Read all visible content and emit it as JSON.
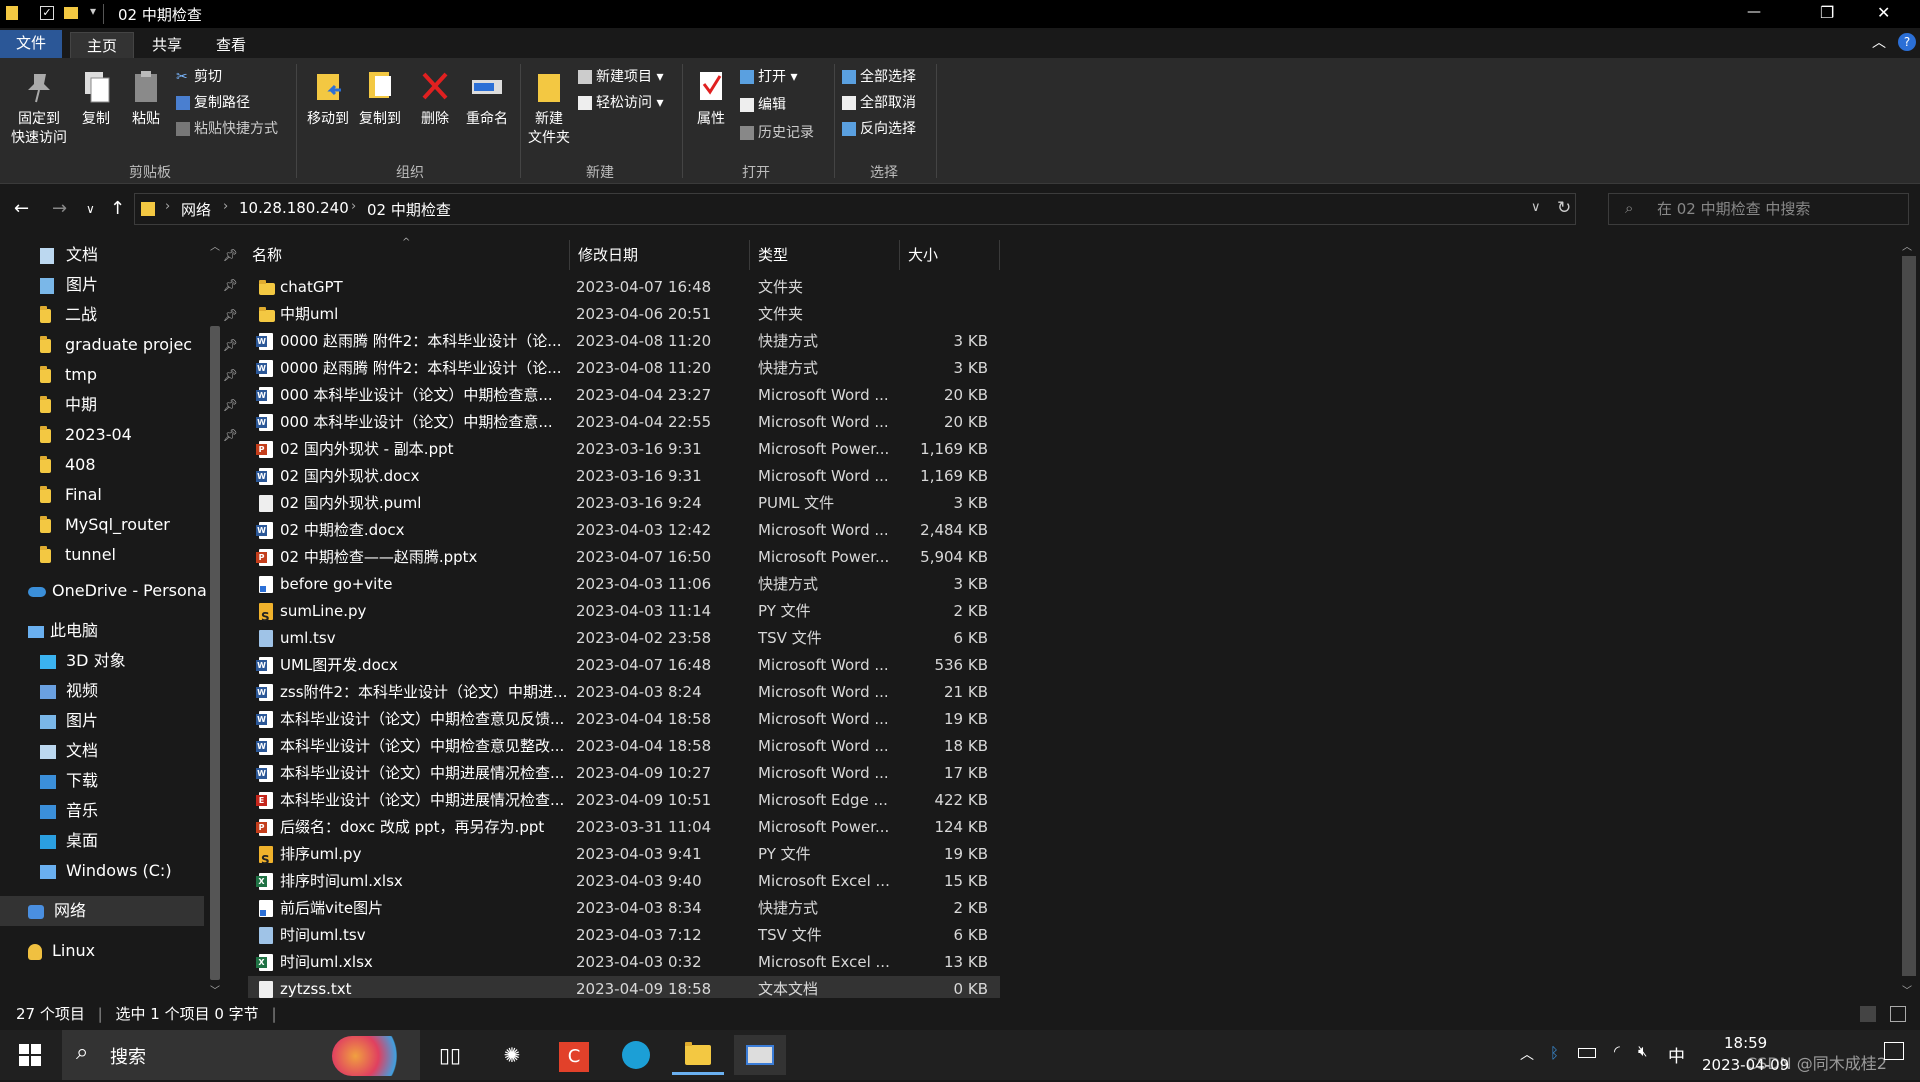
{
  "titlebar": {
    "title": "02 中期检查",
    "qat_dropdown": "▾",
    "minimize": "—",
    "restore": "❐",
    "close": "✕"
  },
  "ribbon_tabs": [
    {
      "label": "文件"
    },
    {
      "label": "主页"
    },
    {
      "label": "共享"
    },
    {
      "label": "查看"
    }
  ],
  "ribbon": {
    "pin_quick_access": "固定到\n快速访问",
    "copy": "复制",
    "paste": "粘贴",
    "cut": "剪切",
    "copy_path": "复制路径",
    "paste_shortcut": "粘贴快捷方式",
    "group_clipboard": "剪贴板",
    "move_to": "移动到",
    "copy_to": "复制到",
    "delete": "删除",
    "rename": "重命名",
    "group_organize": "组织",
    "new_folder": "新建\n文件夹",
    "new_item": "新建项目",
    "easy_access": "轻松访问",
    "group_new": "新建",
    "properties": "属性",
    "open": "打开",
    "edit": "编辑",
    "history": "历史记录",
    "group_open": "打开",
    "select_all": "全部选择",
    "select_none": "全部取消",
    "invert_selection": "反向选择",
    "group_select": "选择"
  },
  "address": {
    "crumbs": [
      "网络",
      "10.28.180.240",
      "02 中期检查"
    ],
    "search_placeholder": "在 02 中期检查 中搜索"
  },
  "nav_pane": {
    "quick_access": [
      {
        "label": "文档",
        "icon": "documents-icon",
        "pinned": true
      },
      {
        "label": "图片",
        "icon": "pictures-icon",
        "pinned": true
      },
      {
        "label": "二战",
        "icon": "folder-icon",
        "pinned": true
      },
      {
        "label": "graduate projec",
        "icon": "folder-icon",
        "pinned": true
      },
      {
        "label": "tmp",
        "icon": "folder-icon",
        "pinned": true
      },
      {
        "label": "中期",
        "icon": "folder-icon",
        "pinned": true
      },
      {
        "label": "2023-04",
        "icon": "folder-icon",
        "pinned": true
      },
      {
        "label": "408",
        "icon": "folder-icon",
        "pinned": false
      },
      {
        "label": "Final",
        "icon": "folder-icon",
        "pinned": false
      },
      {
        "label": "MySql_router",
        "icon": "folder-icon",
        "pinned": false
      },
      {
        "label": "tunnel",
        "icon": "folder-icon",
        "pinned": false
      }
    ],
    "onedrive": "OneDrive - Personal",
    "this_pc": "此电脑",
    "this_pc_items": [
      {
        "label": "3D 对象",
        "icon": "3d-objects-icon"
      },
      {
        "label": "视频",
        "icon": "videos-icon"
      },
      {
        "label": "图片",
        "icon": "pictures-icon"
      },
      {
        "label": "文档",
        "icon": "documents-icon"
      },
      {
        "label": "下载",
        "icon": "downloads-icon"
      },
      {
        "label": "音乐",
        "icon": "music-icon"
      },
      {
        "label": "桌面",
        "icon": "desktop-icon"
      },
      {
        "label": "Windows (C:)",
        "icon": "drive-icon"
      }
    ],
    "network": "网络",
    "linux": "Linux"
  },
  "columns": {
    "name": "名称",
    "date": "修改日期",
    "type": "类型",
    "size": "大小"
  },
  "files": [
    {
      "name": "chatGPT",
      "date": "2023-04-07 16:48",
      "type": "文件夹",
      "size": "",
      "icon": "folder"
    },
    {
      "name": "中期uml",
      "date": "2023-04-06 20:51",
      "type": "文件夹",
      "size": "",
      "icon": "folder"
    },
    {
      "name": "0000 赵雨腾 附件2：本科毕业设计（论...",
      "date": "2023-04-08 11:20",
      "type": "快捷方式",
      "size": "3 KB",
      "icon": "word-lnk"
    },
    {
      "name": "0000 赵雨腾 附件2：本科毕业设计（论...",
      "date": "2023-04-08 11:20",
      "type": "快捷方式",
      "size": "3 KB",
      "icon": "word-lnk"
    },
    {
      "name": "000 本科毕业设计（论文）中期检查意...",
      "date": "2023-04-04 23:27",
      "type": "Microsoft Word ...",
      "size": "20 KB",
      "icon": "word"
    },
    {
      "name": "000 本科毕业设计（论文）中期检查意...",
      "date": "2023-04-04 22:55",
      "type": "Microsoft Word ...",
      "size": "20 KB",
      "icon": "word"
    },
    {
      "name": "02 国内外现状 - 副本.ppt",
      "date": "2023-03-16 9:31",
      "type": "Microsoft Power...",
      "size": "1,169 KB",
      "icon": "ppt"
    },
    {
      "name": "02 国内外现状.docx",
      "date": "2023-03-16 9:31",
      "type": "Microsoft Word ...",
      "size": "1,169 KB",
      "icon": "word"
    },
    {
      "name": "02 国内外现状.puml",
      "date": "2023-03-16 9:24",
      "type": "PUML 文件",
      "size": "3 KB",
      "icon": "txt"
    },
    {
      "name": "02 中期检查.docx",
      "date": "2023-04-03 12:42",
      "type": "Microsoft Word ...",
      "size": "2,484 KB",
      "icon": "word"
    },
    {
      "name": "02 中期检查——赵雨腾.pptx",
      "date": "2023-04-07 16:50",
      "type": "Microsoft Power...",
      "size": "5,904 KB",
      "icon": "ppt"
    },
    {
      "name": "before go+vite",
      "date": "2023-04-03 11:06",
      "type": "快捷方式",
      "size": "3 KB",
      "icon": "lnk"
    },
    {
      "name": "sumLine.py",
      "date": "2023-04-03 11:14",
      "type": "PY 文件",
      "size": "2 KB",
      "icon": "py"
    },
    {
      "name": "uml.tsv",
      "date": "2023-04-02 23:58",
      "type": "TSV 文件",
      "size": "6 KB",
      "icon": "tsv"
    },
    {
      "name": "UML图开发.docx",
      "date": "2023-04-07 16:48",
      "type": "Microsoft Word ...",
      "size": "536 KB",
      "icon": "word"
    },
    {
      "name": "zss附件2：本科毕业设计（论文）中期进...",
      "date": "2023-04-03 8:24",
      "type": "Microsoft Word ...",
      "size": "21 KB",
      "icon": "word"
    },
    {
      "name": "本科毕业设计（论文）中期检查意见反馈...",
      "date": "2023-04-04 18:58",
      "type": "Microsoft Word ...",
      "size": "19 KB",
      "icon": "word"
    },
    {
      "name": "本科毕业设计（论文）中期检查意见整改...",
      "date": "2023-04-04 18:58",
      "type": "Microsoft Word ...",
      "size": "18 KB",
      "icon": "word"
    },
    {
      "name": "本科毕业设计（论文）中期进展情况检查...",
      "date": "2023-04-09 10:27",
      "type": "Microsoft Word ...",
      "size": "17 KB",
      "icon": "word"
    },
    {
      "name": "本科毕业设计（论文）中期进展情况检查...",
      "date": "2023-04-09 10:51",
      "type": "Microsoft Edge ...",
      "size": "422 KB",
      "icon": "pdf"
    },
    {
      "name": "后缀名：doxc 改成 ppt，再另存为.ppt",
      "date": "2023-03-31 11:04",
      "type": "Microsoft Power...",
      "size": "124 KB",
      "icon": "ppt"
    },
    {
      "name": "排序uml.py",
      "date": "2023-04-03 9:41",
      "type": "PY 文件",
      "size": "19 KB",
      "icon": "py"
    },
    {
      "name": "排序时间uml.xlsx",
      "date": "2023-04-03 9:40",
      "type": "Microsoft Excel ...",
      "size": "15 KB",
      "icon": "xls"
    },
    {
      "name": "前后端vite图片",
      "date": "2023-04-03 8:34",
      "type": "快捷方式",
      "size": "2 KB",
      "icon": "lnk"
    },
    {
      "name": "时间uml.tsv",
      "date": "2023-04-03 7:12",
      "type": "TSV 文件",
      "size": "6 KB",
      "icon": "tsv"
    },
    {
      "name": "时间uml.xlsx",
      "date": "2023-04-03 0:32",
      "type": "Microsoft Excel ...",
      "size": "13 KB",
      "icon": "xls"
    },
    {
      "name": "zytzss.txt",
      "date": "2023-04-09 18:58",
      "type": "文本文档",
      "size": "0 KB",
      "icon": "txt",
      "selected": true
    }
  ],
  "status": {
    "count": "27 个项目",
    "selected": "选中 1 个项目 0 字节"
  },
  "taskbar": {
    "search": "搜索",
    "ime": "中",
    "time": "18:59",
    "date": "2023-04-09",
    "watermark": "CSDN @同木成桂2"
  }
}
